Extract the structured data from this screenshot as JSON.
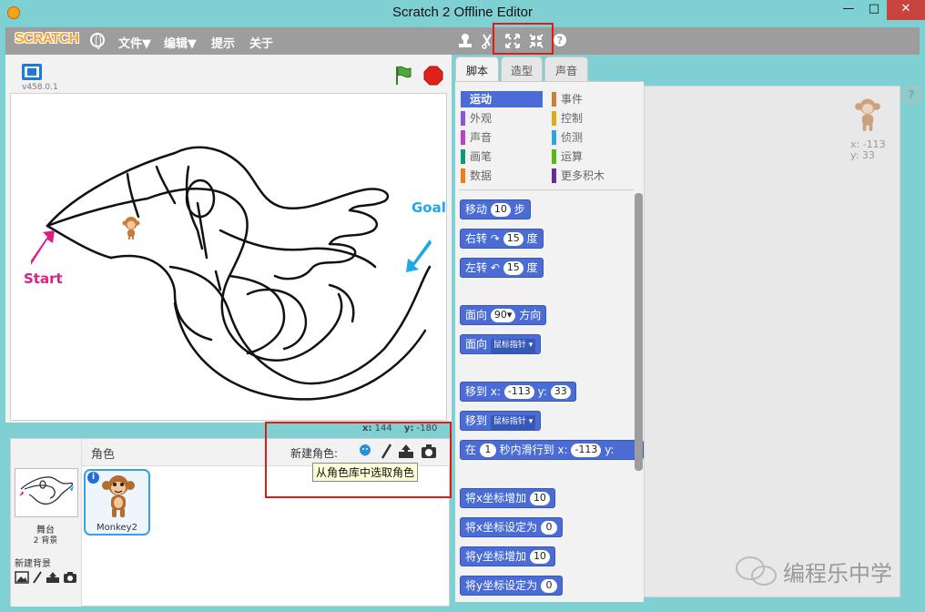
{
  "window": {
    "title": "Scratch 2 Offline Editor",
    "min_label": "—",
    "max_label": "□",
    "close_label": "✕"
  },
  "menubar": {
    "logo_text": "SCRATCH",
    "menus": [
      "文件▼",
      "编辑▼",
      "提示",
      "关于"
    ]
  },
  "stage": {
    "version": "v458.0.1",
    "labels": {
      "start": "Start",
      "goal": "Goal"
    },
    "mouse_x_label": "x:",
    "mouse_x": "144",
    "mouse_y_label": "y:",
    "mouse_y": "-180"
  },
  "sprites_pane": {
    "title": "角色",
    "new_sprite_label": "新建角色:",
    "tooltip": "从角色库中选取角色",
    "stage_label": "舞台",
    "stage_backdrops": "2 背景",
    "new_backdrop_label": "新建背景",
    "sprites": [
      {
        "name": "Monkey2"
      }
    ]
  },
  "tabs": [
    "脚本",
    "造型",
    "声音"
  ],
  "categories": {
    "left": [
      {
        "label": "运动",
        "color": "#4a6cd4"
      },
      {
        "label": "外观",
        "color": "#8a55d7"
      },
      {
        "label": "声音",
        "color": "#bb42c3"
      },
      {
        "label": "画笔",
        "color": "#0e9a6c"
      },
      {
        "label": "数据",
        "color": "#ee7d16"
      }
    ],
    "right": [
      {
        "label": "事件",
        "color": "#c88330"
      },
      {
        "label": "控制",
        "color": "#e1a91a"
      },
      {
        "label": "侦测",
        "color": "#2ca5e2"
      },
      {
        "label": "运算",
        "color": "#5cb712"
      },
      {
        "label": "更多积木",
        "color": "#632d99"
      }
    ]
  },
  "blocks": {
    "move": {
      "pre": "移动",
      "val": "10",
      "post": "步"
    },
    "turn_right": {
      "pre": "右转",
      "val": "15",
      "post": "度"
    },
    "turn_left": {
      "pre": "左转",
      "val": "15",
      "post": "度"
    },
    "point_dir": {
      "pre": "面向",
      "val": "90▾",
      "post": "方向"
    },
    "point_towards": {
      "pre": "面向",
      "drop": "鼠标指针"
    },
    "goto_xy": {
      "pre": "移到 x:",
      "x": "-113",
      "mid": "y:",
      "y": "33"
    },
    "goto": {
      "pre": "移到",
      "drop": "鼠标指针"
    },
    "glide": {
      "pre": "在",
      "secs": "1",
      "mid": "秒内滑行到 x:",
      "x": "-113",
      "post": "y:"
    },
    "change_x": {
      "pre": "将x坐标增加",
      "val": "10"
    },
    "set_x": {
      "pre": "将x坐标设定为",
      "val": "0"
    },
    "change_y": {
      "pre": "将y坐标增加",
      "val": "10"
    },
    "set_y": {
      "pre": "将y坐标设定为",
      "val": "0"
    }
  },
  "script_area": {
    "x_label": "x:",
    "x": "-113",
    "y_label": "y:",
    "y": "33"
  },
  "watermark": {
    "text": "编程乐中学"
  }
}
